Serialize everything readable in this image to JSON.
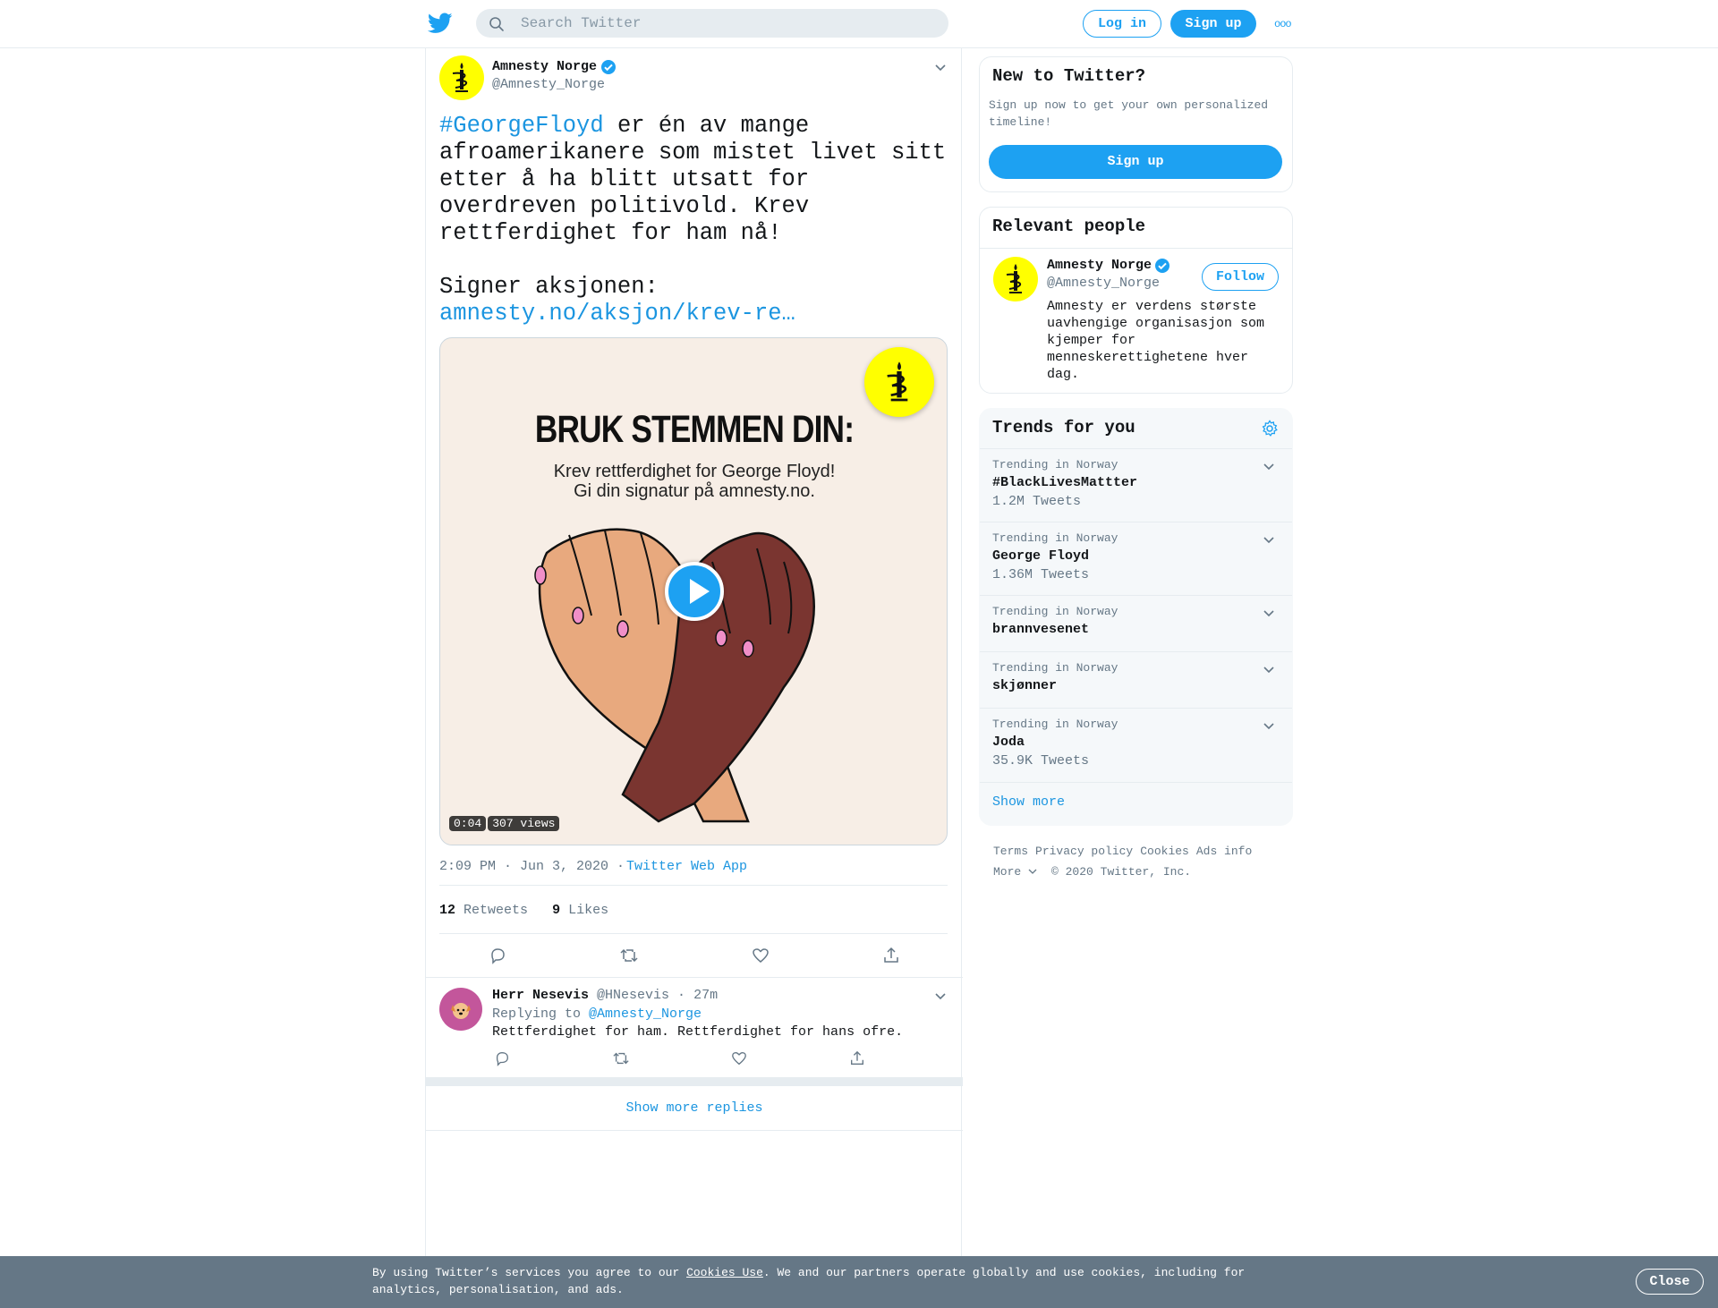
{
  "header": {
    "search_placeholder": "Search Twitter",
    "login_label": "Log in",
    "signup_label": "Sign up",
    "more_icon": "ooo"
  },
  "tweet": {
    "author_name": "Amnesty Norge",
    "author_handle": "@Amnesty_Norge",
    "hashtag": "#GeorgeFloyd",
    "text_rest": " er én av mange afroamerikanere som mistet livet sitt etter å ha blitt utsatt for overdreven politivold. Krev rettferdighet for ham nå!",
    "sign_label": "Signer aksjonen: ",
    "link_text": "amnesty.no/aksjon/krev-re…",
    "media": {
      "headline": "BRUK STEMMEN DIN:",
      "sub1": "Krev rettferdighet for George Floyd!",
      "sub2": "Gi din signatur på amnesty.no.",
      "duration": "0:04",
      "views": "307 views"
    },
    "timestamp": "2:09 PM · Jun 3, 2020 ·",
    "source": "Twitter Web App",
    "retweets_count": "12",
    "retweets_label": "Retweets",
    "likes_count": "9",
    "likes_label": "Likes"
  },
  "reply": {
    "name": "Herr Nesevis",
    "handle_time": "@HNesevis · 27m",
    "replying_prefix": "Replying to ",
    "replying_handle": "@Amnesty_Norge",
    "text": "Rettferdighet for ham. Rettferdighet for hans ofre."
  },
  "show_more_replies": "Show more replies",
  "sidebar": {
    "new_title": "New to Twitter?",
    "new_desc": "Sign up now to get your own personalized timeline!",
    "new_button": "Sign up",
    "people_title": "Relevant people",
    "person_name": "Amnesty Norge",
    "person_handle": "@Amnesty_Norge",
    "follow_label": "Follow",
    "person_bio": "Amnesty er verdens største uavhengige organisasjon som kjemper for menneskerettighetene hver dag.",
    "trends_title": "Trends for you",
    "trends": [
      {
        "context": "Trending in Norway",
        "name": "#BlackLivesMattter",
        "count": "1.2M Tweets"
      },
      {
        "context": "Trending in Norway",
        "name": "George Floyd",
        "count": "1.36M Tweets"
      },
      {
        "context": "Trending in Norway",
        "name": "brannvesenet",
        "count": ""
      },
      {
        "context": "Trending in Norway",
        "name": "skjønner",
        "count": ""
      },
      {
        "context": "Trending in Norway",
        "name": "Joda",
        "count": "35.9K Tweets"
      }
    ],
    "trends_more": "Show more",
    "footer": [
      "Terms",
      "Privacy policy",
      "Cookies",
      "Ads info",
      "More",
      "© 2020 Twitter, Inc."
    ]
  },
  "cookie": {
    "text_before": "By using Twitter’s services you agree to our ",
    "link": "Cookies Use",
    "text_after": ". We and our partners operate globally and use cookies, including for analytics, personalisation, and ads.",
    "close_label": "Close"
  },
  "colors": {
    "brand": "#1da1f2",
    "link": "#1b95e0",
    "amnesty_yellow": "#ffff00"
  }
}
